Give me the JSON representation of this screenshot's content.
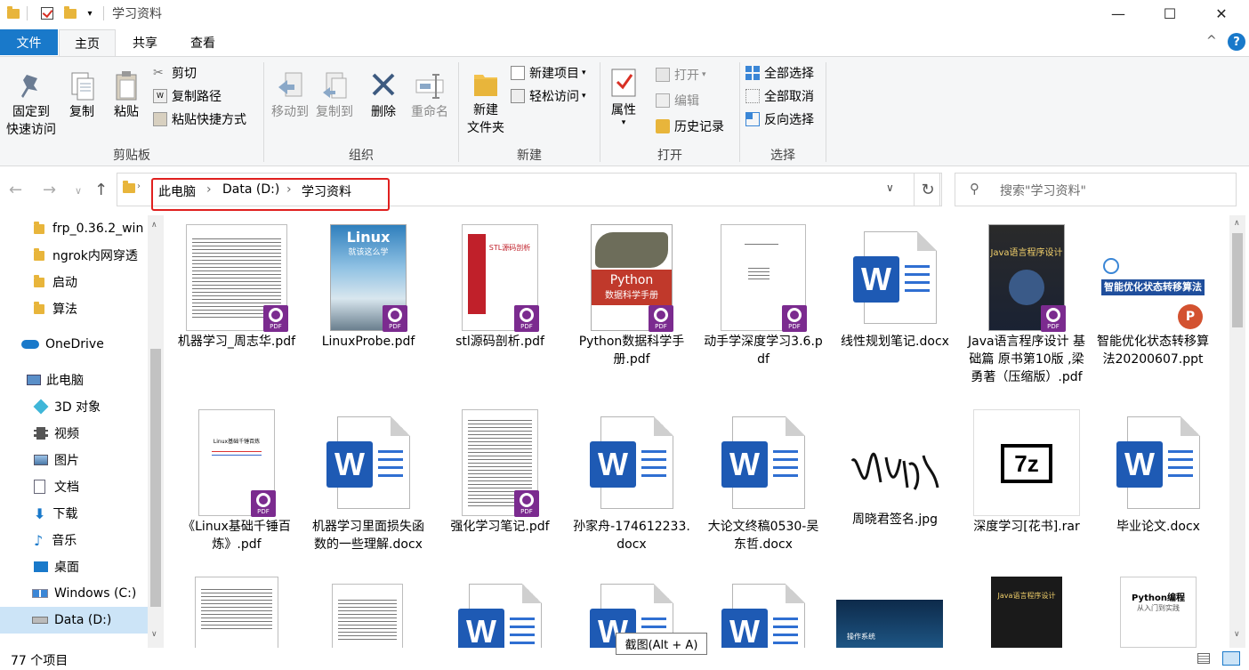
{
  "window": {
    "title": "学习资料",
    "minimize": "—",
    "maximize": "☐",
    "close": "✕"
  },
  "tabs": {
    "file": "文件",
    "home": "主页",
    "share": "共享",
    "view": "查看",
    "help": "?",
    "collapse": "^"
  },
  "ribbon": {
    "clipboard": {
      "label": "剪贴板",
      "pin": "固定到\n快速访问",
      "copy": "复制",
      "paste": "粘贴",
      "cut": "剪切",
      "copy_path": "复制路径",
      "paste_shortcut": "粘贴快捷方式"
    },
    "organize": {
      "label": "组织",
      "move_to": "移动到",
      "copy_to": "复制到",
      "delete": "删除",
      "rename": "重命名"
    },
    "new": {
      "label": "新建",
      "new_folder": "新建\n文件夹",
      "new_item": "新建项目",
      "easy_access": "轻松访问"
    },
    "open": {
      "label": "打开",
      "properties": "属性",
      "open": "打开",
      "edit": "编辑",
      "history": "历史记录"
    },
    "select": {
      "label": "选择",
      "select_all": "全部选择",
      "select_none": "全部取消",
      "invert": "反向选择"
    }
  },
  "address": {
    "crumbs": [
      "此电脑",
      "Data (D:)",
      "学习资料"
    ],
    "search_placeholder": "搜索\"学习资料\""
  },
  "nav": {
    "items": [
      {
        "label": "frp_0.36.2_win",
        "icon": "folder-icon"
      },
      {
        "label": "ngrok内网穿透",
        "icon": "folder-icon"
      },
      {
        "label": "启动",
        "icon": "folder-icon"
      },
      {
        "label": "算法",
        "icon": "folder-icon"
      },
      {
        "label": "OneDrive",
        "icon": "cloud-icon"
      },
      {
        "label": "此电脑",
        "icon": "computer-icon"
      },
      {
        "label": "3D 对象",
        "icon": "cube-icon"
      },
      {
        "label": "视频",
        "icon": "video-icon"
      },
      {
        "label": "图片",
        "icon": "picture-icon"
      },
      {
        "label": "文档",
        "icon": "document-icon"
      },
      {
        "label": "下载",
        "icon": "download-icon"
      },
      {
        "label": "音乐",
        "icon": "music-icon"
      },
      {
        "label": "桌面",
        "icon": "desktop-icon"
      },
      {
        "label": "Windows (C:)",
        "icon": "drive-icon"
      },
      {
        "label": "Data (D:)",
        "icon": "drive-icon"
      }
    ]
  },
  "files": {
    "row1": [
      {
        "name": "机器学习_周志华.pdf",
        "type": "pdf"
      },
      {
        "name": "LinuxProbe.pdf",
        "type": "pdf",
        "cover_text": "Linux",
        "cover_sub": "就该这么学"
      },
      {
        "name": "stl源码剖析.pdf",
        "type": "pdf",
        "cover_text": "STL源码剖析"
      },
      {
        "name": "Python数据科学手册.pdf",
        "type": "pdf",
        "cover_text": "Python",
        "cover_sub": "数据科学手册"
      },
      {
        "name": "动手学深度学习3.6.pdf",
        "type": "pdf"
      },
      {
        "name": "线性规划笔记.docx",
        "type": "docx"
      },
      {
        "name": "Java语言程序设计 基础篇 原书第10版 ,梁勇著（压缩版）.pdf",
        "type": "pdf",
        "cover_text": "Java语言程序设计"
      },
      {
        "name": "智能优化状态转移算法20200607.ppt",
        "type": "ppt",
        "cover_text": "智能优化状态转移算法"
      }
    ],
    "row2": [
      {
        "name": "《Linux基础千锤百炼》.pdf",
        "type": "pdf",
        "cover_text": "Linux基础千锤百炼"
      },
      {
        "name": "机器学习里面损失函数的一些理解.docx",
        "type": "docx"
      },
      {
        "name": "强化学习笔记.pdf",
        "type": "pdf"
      },
      {
        "name": "孙家舟-174612233.docx",
        "type": "docx"
      },
      {
        "name": "大论文终稿0530-吴东哲.docx",
        "type": "docx"
      },
      {
        "name": "周晓君签名.jpg",
        "type": "jpg"
      },
      {
        "name": "深度学习[花书].rar",
        "type": "rar",
        "cover_text": "7z"
      },
      {
        "name": "毕业论文.docx",
        "type": "docx"
      }
    ],
    "row3": [
      {
        "type": "pdf"
      },
      {
        "type": "txt"
      },
      {
        "type": "docx"
      },
      {
        "type": "docx"
      },
      {
        "type": "docx"
      },
      {
        "type": "img",
        "cover_text": "操作系统"
      },
      {
        "type": "pdf",
        "cover_text": "Java语言程序设计"
      },
      {
        "type": "pdf",
        "cover_text": "Python编程",
        "cover_sub": "从入门到实践"
      }
    ]
  },
  "status": {
    "count": "77 个项目"
  },
  "tooltip": "截图(Alt + A)",
  "colors": {
    "accent": "#1979ca",
    "highlight_border": "#e0201f",
    "pdf_badge": "#7b2b8f",
    "word_blue": "#1e5ab4"
  }
}
